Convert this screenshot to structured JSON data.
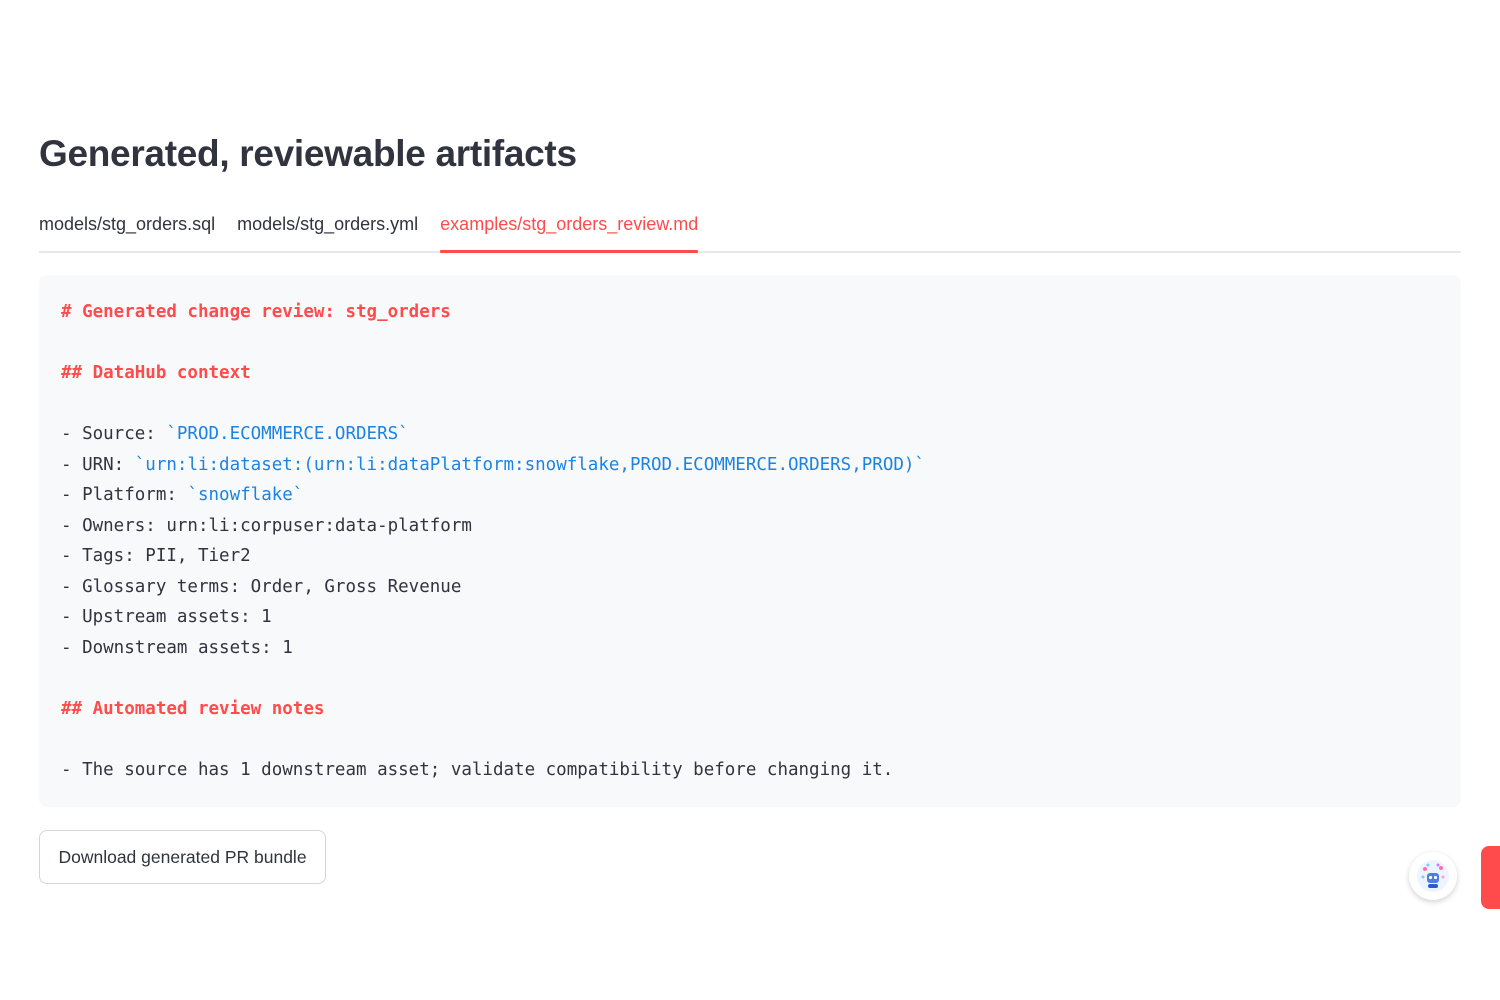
{
  "heading": "Generated, reviewable artifacts",
  "tabs": [
    {
      "label": "models/stg_orders.sql",
      "active": false
    },
    {
      "label": "models/stg_orders.yml",
      "active": false
    },
    {
      "label": "examples/stg_orders_review.md",
      "active": true
    }
  ],
  "review": {
    "title": "# Generated change review: stg_orders",
    "context_heading": "## DataHub context",
    "source_label": "- Source: ",
    "source_value": "`PROD.ECOMMERCE.ORDERS`",
    "urn_label": "- URN: ",
    "urn_value": "`urn:li:dataset:(urn:li:dataPlatform:snowflake,PROD.ECOMMERCE.ORDERS,PROD)`",
    "platform_label": "- Platform: ",
    "platform_value": "`snowflake`",
    "owners": "- Owners: urn:li:corpuser:data-platform",
    "tags": "- Tags: PII, Tier2",
    "glossary": "- Glossary terms: Order, Gross Revenue",
    "upstream": "- Upstream assets: 1",
    "downstream": "- Downstream assets: 1",
    "notes_heading": "## Automated review notes",
    "note_1": "- The source has 1 downstream asset; validate compatibility before changing it."
  },
  "download_button": "Download generated PR bundle",
  "icons": {
    "assistant": "assistant-avatar-icon"
  },
  "colors": {
    "accent": "#ff4b4b",
    "code_link": "#1c83e1",
    "text": "#31333f"
  }
}
